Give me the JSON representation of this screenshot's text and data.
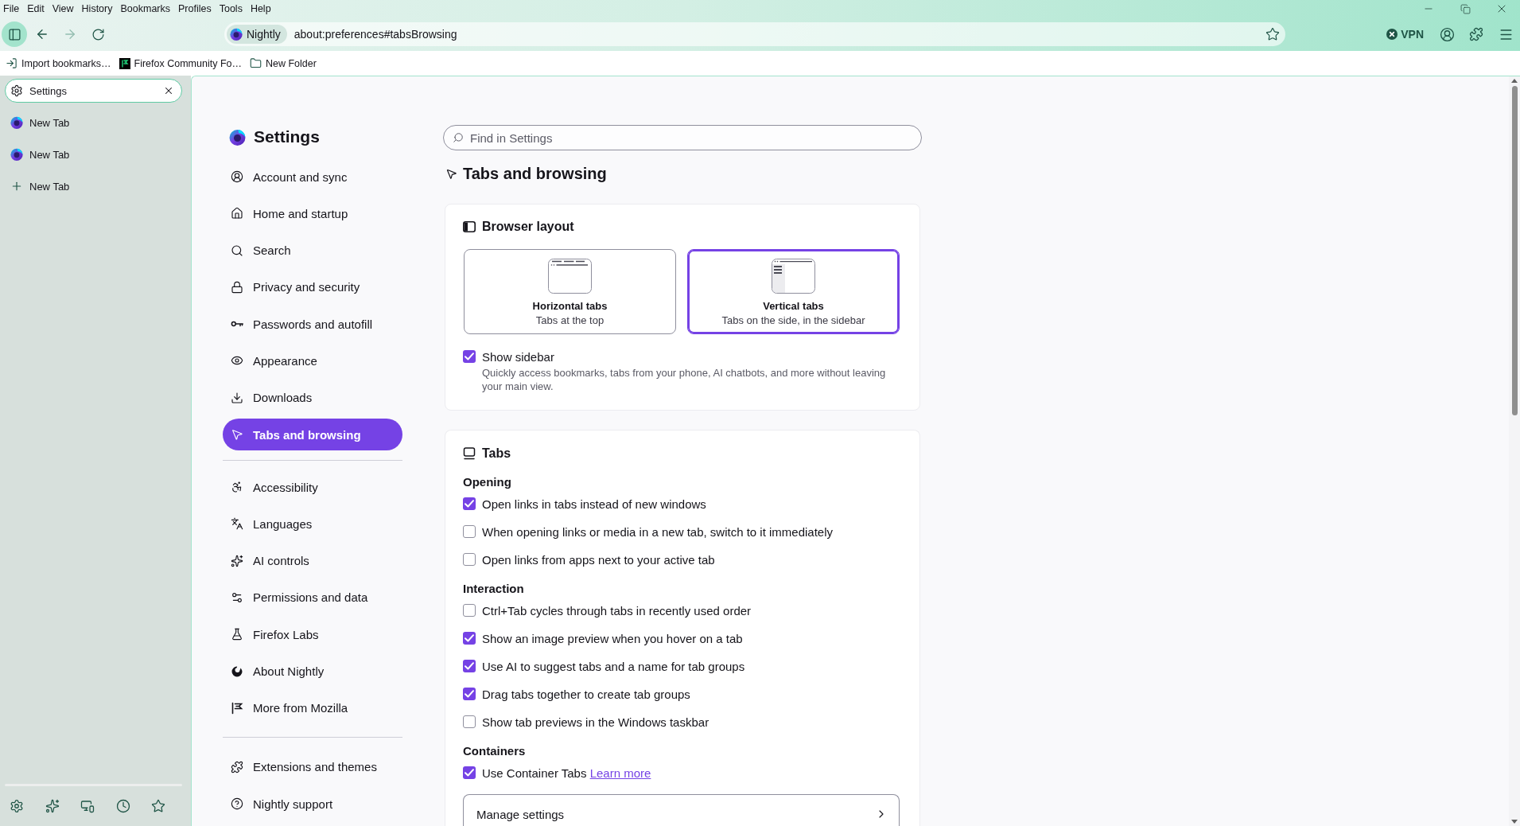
{
  "menu_bar": [
    {
      "label": "File"
    },
    {
      "label": "Edit"
    },
    {
      "label": "View"
    },
    {
      "label": "History"
    },
    {
      "label": "Bookmarks"
    },
    {
      "label": "Profiles"
    },
    {
      "label": "Tools"
    },
    {
      "label": "Help"
    }
  ],
  "toolbar": {
    "sidebar_on": true,
    "forward_disabled": true,
    "identity": "Nightly",
    "url": "about:preferences#tabsBrowsing",
    "vpn": "VPN"
  },
  "bookmarks_bar": [
    {
      "kind": "import",
      "label": "Import bookmarks…"
    },
    {
      "kind": "site",
      "label": "Firefox Community Fo…"
    },
    {
      "kind": "folder",
      "label": "New Folder"
    }
  ],
  "sidebar": {
    "tabs": [
      {
        "kind": "settings",
        "label": "Settings",
        "selected": true
      },
      {
        "kind": "page",
        "label": "New Tab",
        "selected": false
      },
      {
        "kind": "page",
        "label": "New Tab",
        "selected": false
      }
    ],
    "new_tab": "New Tab"
  },
  "settings_nav": {
    "title": "Settings",
    "groups": [
      {
        "items": [
          {
            "label": "Account and sync",
            "selected": false
          },
          {
            "label": "Home and startup",
            "selected": false
          },
          {
            "label": "Search",
            "selected": false
          },
          {
            "label": "Privacy and security",
            "selected": false
          },
          {
            "label": "Passwords and autofill",
            "selected": false
          },
          {
            "label": "Appearance",
            "selected": false
          },
          {
            "label": "Downloads",
            "selected": false
          },
          {
            "label": "Tabs and browsing",
            "selected": true
          }
        ]
      },
      {
        "items": [
          {
            "label": "Accessibility",
            "selected": false
          },
          {
            "label": "Languages",
            "selected": false
          },
          {
            "label": "AI controls",
            "selected": false
          },
          {
            "label": "Permissions and data",
            "selected": false
          },
          {
            "label": "Firefox Labs",
            "selected": false
          },
          {
            "label": "About Nightly",
            "selected": false
          },
          {
            "label": "More from Mozilla",
            "selected": false
          }
        ]
      },
      {
        "items": [
          {
            "label": "Extensions and themes",
            "selected": false
          },
          {
            "label": "Nightly support",
            "selected": false
          }
        ]
      }
    ]
  },
  "search": {
    "placeholder": "Find in Settings"
  },
  "page_title": "Tabs and browsing",
  "sections": [
    {
      "kind": "layout",
      "title": "Browser layout",
      "options": [
        {
          "kind": "horizontal",
          "title": "Horizontal tabs",
          "subtitle": "Tabs at the top",
          "selected": false
        },
        {
          "kind": "vertical",
          "title": "Vertical tabs",
          "subtitle": "Tabs on the side, in the sidebar",
          "selected": true
        }
      ],
      "checkboxes": [
        {
          "label": "Show sidebar",
          "checked": true,
          "description": "Quickly access bookmarks, tabs from your phone, AI chatbots, and more without leaving your main view."
        }
      ]
    },
    {
      "kind": "tabs",
      "title": "Tabs",
      "groups": [
        {
          "heading": "Opening",
          "options": [
            {
              "label": "Open links in tabs instead of new windows",
              "checked": true
            },
            {
              "label": "When opening links or media in a new tab, switch to it immediately",
              "checked": false
            },
            {
              "label": "Open links from apps next to your active tab",
              "checked": false
            }
          ]
        },
        {
          "heading": "Interaction",
          "options": [
            {
              "label": "Ctrl+Tab cycles through tabs in recently used order",
              "checked": false
            },
            {
              "label": "Show an image preview when you hover on a tab",
              "checked": true
            },
            {
              "label": "Use AI to suggest tabs and a name for tab groups",
              "checked": true
            },
            {
              "label": "Drag tabs together to create tab groups",
              "checked": true
            },
            {
              "label": "Show tab previews in the Windows taskbar",
              "checked": false
            }
          ]
        },
        {
          "heading": "Containers",
          "options": [
            {
              "label": "Use Container Tabs",
              "checked": true,
              "link": "Learn more"
            }
          ]
        }
      ],
      "button": {
        "label": "Manage settings"
      }
    }
  ]
}
